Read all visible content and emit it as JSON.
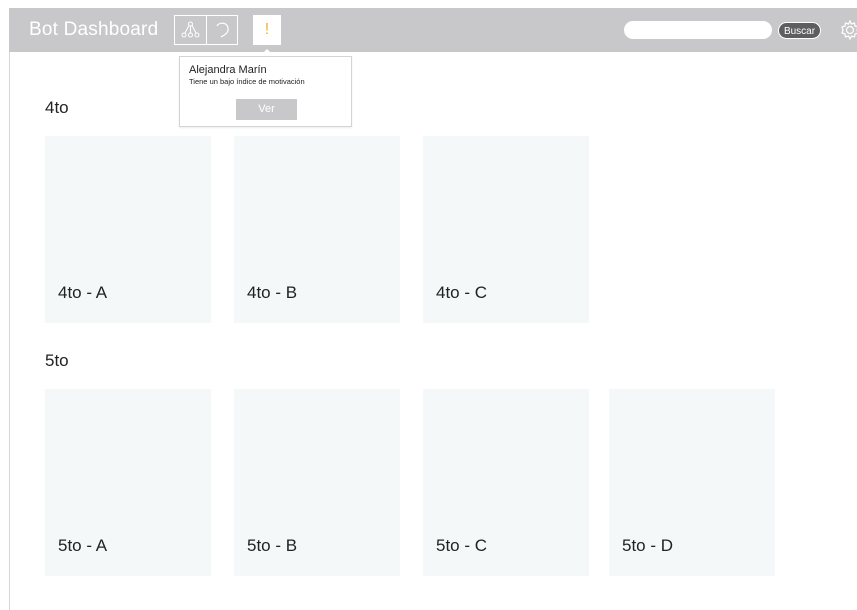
{
  "header": {
    "title": "Bot Dashboard",
    "alert_glyph": "!",
    "search": {
      "placeholder": "",
      "value": "",
      "button_label": "Buscar"
    },
    "icons": [
      "network-icon",
      "refresh-icon",
      "alert-icon",
      "gear-icon"
    ]
  },
  "notification": {
    "name": "Alejandra Marín",
    "message": "Tiene un bajo índice de motivación",
    "button_label": "Ver"
  },
  "sections": [
    {
      "title": "4to",
      "cards": [
        {
          "label": "4to - A"
        },
        {
          "label": "4to - B"
        },
        {
          "label": "4to - C"
        }
      ]
    },
    {
      "title": "5to",
      "cards": [
        {
          "label": "5to - A"
        },
        {
          "label": "5to - B"
        },
        {
          "label": "5to - C"
        },
        {
          "label": "5to - D"
        }
      ]
    }
  ],
  "colors": {
    "topbar": "#c8c8cb",
    "card": "#f4f8f8",
    "alert": "#f0b33a",
    "search_button": "#5e5e60"
  }
}
